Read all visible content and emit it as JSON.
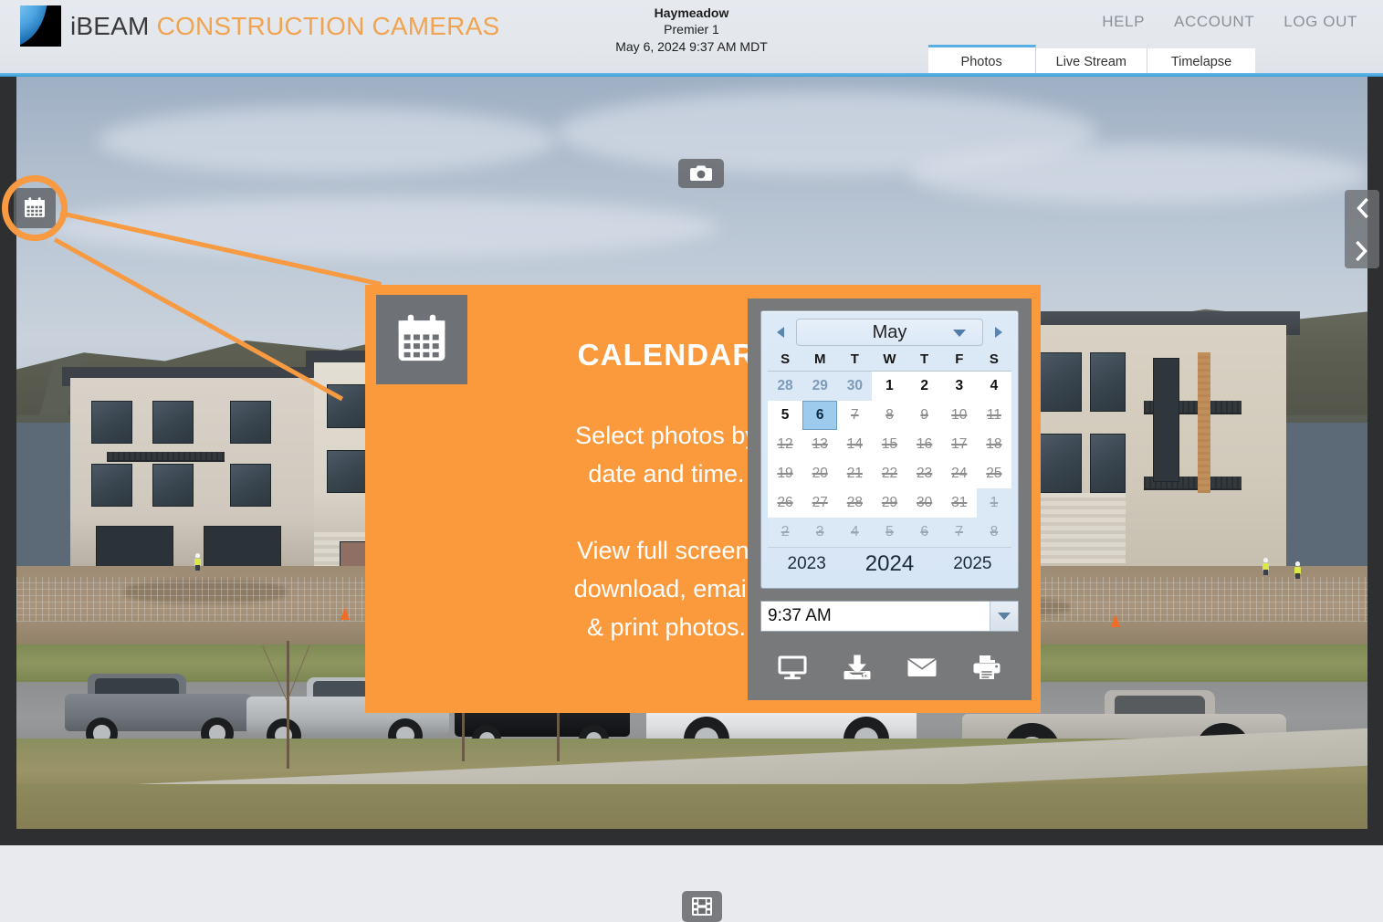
{
  "header": {
    "brand_primary": "iBEAM",
    "brand_secondary": "CONSTRUCTION CAMERAS",
    "site_name": "Haymeadow",
    "site_subtitle": "Premier 1",
    "site_datetime": "May 6, 2024 9:37 AM MDT",
    "nav": [
      {
        "label": "HELP"
      },
      {
        "label": "ACCOUNT"
      },
      {
        "label": "LOG OUT"
      }
    ],
    "tabs": [
      {
        "label": "Photos",
        "active": true
      },
      {
        "label": "Live Stream",
        "active": false
      },
      {
        "label": "Timelapse",
        "active": false
      }
    ],
    "accent_blue": "#4aa8de",
    "brand_orange": "#f0a350"
  },
  "viewer": {
    "camera_button": "camera-icon",
    "filmstrip_button": "film-icon",
    "calendar_button": "calendar-icon",
    "prev_arrow": "chevron-left-icon",
    "next_arrow": "chevron-right-icon",
    "highlight_color": "#f79a41"
  },
  "callout": {
    "icon": "calendar-icon",
    "title": "CALENDAR",
    "paragraph1": "Select photos by\ndate and time.",
    "paragraph2": "View full screen,\ndownload, email,\n& print photos.",
    "background_color": "#fb9a3c",
    "icon_background": "#6e7175"
  },
  "datepicker": {
    "panel_background": "#78797b",
    "prev_month_icon": "triangle-left-icon",
    "next_month_icon": "triangle-right-icon",
    "month": "May",
    "month_caret": "caret-down-icon",
    "weekdays": [
      "S",
      "M",
      "T",
      "W",
      "T",
      "F",
      "S"
    ],
    "weeks": [
      [
        {
          "d": "28",
          "other": true,
          "dim": false,
          "strike": false,
          "selected": false
        },
        {
          "d": "29",
          "other": true,
          "dim": false,
          "strike": false,
          "selected": false
        },
        {
          "d": "30",
          "other": true,
          "dim": false,
          "strike": false,
          "selected": false
        },
        {
          "d": "1",
          "other": false,
          "dim": false,
          "strike": false,
          "selected": false
        },
        {
          "d": "2",
          "other": false,
          "dim": false,
          "strike": false,
          "selected": false
        },
        {
          "d": "3",
          "other": false,
          "dim": false,
          "strike": false,
          "selected": false
        },
        {
          "d": "4",
          "other": false,
          "dim": false,
          "strike": false,
          "selected": false
        }
      ],
      [
        {
          "d": "5",
          "other": false,
          "dim": false,
          "strike": false,
          "selected": false
        },
        {
          "d": "6",
          "other": false,
          "dim": false,
          "strike": false,
          "selected": true
        },
        {
          "d": "7",
          "other": false,
          "dim": true,
          "strike": true,
          "selected": false
        },
        {
          "d": "8",
          "other": false,
          "dim": true,
          "strike": true,
          "selected": false
        },
        {
          "d": "9",
          "other": false,
          "dim": true,
          "strike": true,
          "selected": false
        },
        {
          "d": "10",
          "other": false,
          "dim": true,
          "strike": true,
          "selected": false
        },
        {
          "d": "11",
          "other": false,
          "dim": true,
          "strike": true,
          "selected": false
        }
      ],
      [
        {
          "d": "12",
          "other": false,
          "dim": true,
          "strike": true,
          "selected": false
        },
        {
          "d": "13",
          "other": false,
          "dim": true,
          "strike": true,
          "selected": false
        },
        {
          "d": "14",
          "other": false,
          "dim": true,
          "strike": true,
          "selected": false
        },
        {
          "d": "15",
          "other": false,
          "dim": true,
          "strike": true,
          "selected": false
        },
        {
          "d": "16",
          "other": false,
          "dim": true,
          "strike": true,
          "selected": false
        },
        {
          "d": "17",
          "other": false,
          "dim": true,
          "strike": true,
          "selected": false
        },
        {
          "d": "18",
          "other": false,
          "dim": true,
          "strike": true,
          "selected": false
        }
      ],
      [
        {
          "d": "19",
          "other": false,
          "dim": true,
          "strike": true,
          "selected": false
        },
        {
          "d": "20",
          "other": false,
          "dim": true,
          "strike": true,
          "selected": false
        },
        {
          "d": "21",
          "other": false,
          "dim": true,
          "strike": true,
          "selected": false
        },
        {
          "d": "22",
          "other": false,
          "dim": true,
          "strike": true,
          "selected": false
        },
        {
          "d": "23",
          "other": false,
          "dim": true,
          "strike": true,
          "selected": false
        },
        {
          "d": "24",
          "other": false,
          "dim": true,
          "strike": true,
          "selected": false
        },
        {
          "d": "25",
          "other": false,
          "dim": true,
          "strike": true,
          "selected": false
        }
      ],
      [
        {
          "d": "26",
          "other": false,
          "dim": true,
          "strike": true,
          "selected": false
        },
        {
          "d": "27",
          "other": false,
          "dim": true,
          "strike": true,
          "selected": false
        },
        {
          "d": "28",
          "other": false,
          "dim": true,
          "strike": true,
          "selected": false
        },
        {
          "d": "29",
          "other": false,
          "dim": true,
          "strike": true,
          "selected": false
        },
        {
          "d": "30",
          "other": false,
          "dim": true,
          "strike": true,
          "selected": false
        },
        {
          "d": "31",
          "other": false,
          "dim": true,
          "strike": true,
          "selected": false
        },
        {
          "d": "1",
          "other": true,
          "dim": true,
          "strike": true,
          "selected": false
        }
      ],
      [
        {
          "d": "2",
          "other": true,
          "dim": true,
          "strike": true,
          "selected": false
        },
        {
          "d": "3",
          "other": true,
          "dim": true,
          "strike": true,
          "selected": false
        },
        {
          "d": "4",
          "other": true,
          "dim": true,
          "strike": true,
          "selected": false
        },
        {
          "d": "5",
          "other": true,
          "dim": true,
          "strike": true,
          "selected": false
        },
        {
          "d": "6",
          "other": true,
          "dim": true,
          "strike": true,
          "selected": false
        },
        {
          "d": "7",
          "other": true,
          "dim": true,
          "strike": true,
          "selected": false
        },
        {
          "d": "8",
          "other": true,
          "dim": true,
          "strike": true,
          "selected": false
        }
      ]
    ],
    "years": [
      {
        "label": "2023",
        "current": false
      },
      {
        "label": "2024",
        "current": true
      },
      {
        "label": "2025",
        "current": false
      }
    ],
    "time_value": "9:37 AM",
    "time_caret": "caret-down-icon",
    "actions": [
      {
        "name": "fullscreen-monitor-icon",
        "label": "View full screen"
      },
      {
        "name": "download-icon",
        "label": "Download"
      },
      {
        "name": "email-envelope-icon",
        "label": "Email"
      },
      {
        "name": "print-icon",
        "label": "Print"
      }
    ],
    "selected_day_color": "#9ccbee"
  }
}
